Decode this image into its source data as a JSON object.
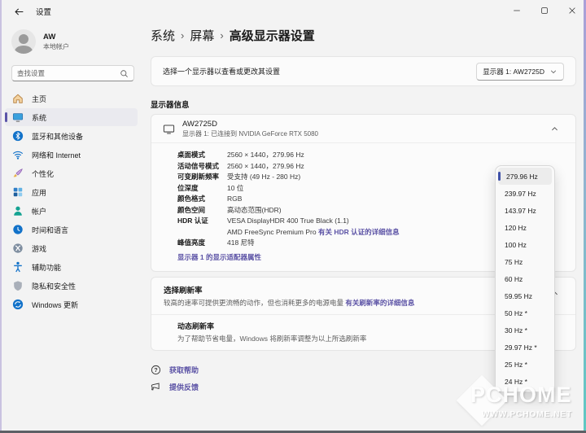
{
  "colors": {
    "accent": "#5b52a5",
    "selection_bar": "#3f51a8",
    "background": "#f3f3f3",
    "card": "#fbfbfb"
  },
  "window": {
    "title": "设置"
  },
  "user": {
    "name": "AW",
    "type": "本地帐户"
  },
  "search": {
    "placeholder": "查找设置"
  },
  "sidebar": {
    "items": [
      {
        "label": "主页",
        "icon": "home-icon"
      },
      {
        "label": "系统",
        "icon": "system-icon",
        "selected": true
      },
      {
        "label": "蓝牙和其他设备",
        "icon": "bluetooth-icon"
      },
      {
        "label": "网络和 Internet",
        "icon": "network-icon"
      },
      {
        "label": "个性化",
        "icon": "personalization-icon"
      },
      {
        "label": "应用",
        "icon": "apps-icon"
      },
      {
        "label": "帐户",
        "icon": "accounts-icon"
      },
      {
        "label": "时间和语言",
        "icon": "time-language-icon"
      },
      {
        "label": "游戏",
        "icon": "gaming-icon"
      },
      {
        "label": "辅助功能",
        "icon": "accessibility-icon"
      },
      {
        "label": "隐私和安全性",
        "icon": "privacy-icon"
      },
      {
        "label": "Windows 更新",
        "icon": "windows-update-icon"
      }
    ]
  },
  "breadcrumb": {
    "seg1": "系统",
    "seg2": "屏幕",
    "current": "高级显示器设置",
    "separator": "›"
  },
  "display_selector": {
    "label": "选择一个显示器以查看或更改其设置",
    "value": "显示器 1: AW2725D"
  },
  "display_info": {
    "section_title": "显示器信息",
    "name": "AW2725D",
    "connection": "显示器 1: 已连接到 NVIDIA GeForce RTX 5080",
    "details": [
      {
        "label": "桌面模式",
        "value": "2560 × 1440，279.96 Hz"
      },
      {
        "label": "活动信号模式",
        "value": "2560 × 1440，279.96 Hz"
      },
      {
        "label": "可变刷新频率",
        "value": "受支持 (49 Hz - 280 Hz)"
      },
      {
        "label": "位深度",
        "value": "10 位"
      },
      {
        "label": "颜色格式",
        "value": "RGB"
      },
      {
        "label": "颜色空间",
        "value": "高动态范围(HDR)"
      },
      {
        "label": "HDR 认证",
        "value": "VESA DisplayHDR 400 True Black (1.1)",
        "value2": "AMD FreeSync Premium Pro ",
        "link": "有关 HDR 认证的详细信息"
      },
      {
        "label": "峰值亮度",
        "value": "418 尼特"
      }
    ],
    "adapter_link": "显示器 1 的显示适配器属性"
  },
  "refresh_rate": {
    "title": "选择刷新率",
    "description": "较高的速率可提供更流畅的动作，但也消耗更多的电源电量 ",
    "link": "有关刷新率的详细信息",
    "dynamic": {
      "title": "动态刷新率",
      "description": "为了帮助节省电量，Windows 将刷新率调整为以上所选刷新率"
    },
    "dropdown": {
      "selected": "279.96 Hz",
      "options": [
        "279.96 Hz",
        "239.97 Hz",
        "143.97 Hz",
        "120 Hz",
        "100 Hz",
        "75 Hz",
        "60 Hz",
        "59.95 Hz",
        "50 Hz *",
        "30 Hz *",
        "29.97 Hz *",
        "25 Hz *",
        "24 Hz *"
      ]
    }
  },
  "footer": {
    "help": "获取帮助",
    "feedback": "提供反馈"
  },
  "watermark": {
    "line1": "PCHOME",
    "line2": "WWW.PCHOME.NET"
  }
}
